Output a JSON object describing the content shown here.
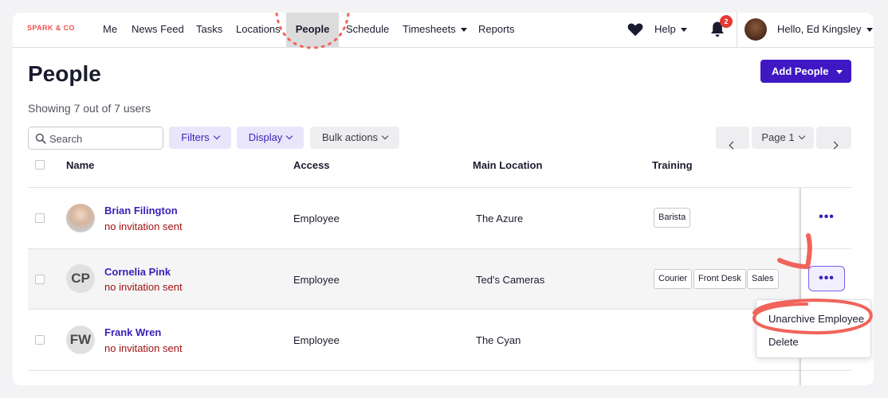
{
  "brand": "SPARK & CO",
  "nav": {
    "items": [
      "Me",
      "News Feed",
      "Tasks",
      "Locations",
      "People",
      "Schedule",
      "Timesheets",
      "Reports"
    ],
    "active": "People",
    "help_label": "Help",
    "notification_count": "2",
    "user_greeting": "Hello, Ed Kingsley"
  },
  "header": {
    "title": "People",
    "add_button": "Add People",
    "showing": "Showing 7 out of 7 users"
  },
  "toolbar": {
    "search_placeholder": "Search",
    "filters": "Filters",
    "display": "Display",
    "bulk_actions": "Bulk actions",
    "page_label": "Page 1"
  },
  "table": {
    "columns": [
      "Name",
      "Access",
      "Main Location",
      "Training"
    ],
    "rows": [
      {
        "initials": "",
        "name": "Brian Filington",
        "status": "no invitation sent",
        "access": "Employee",
        "location": "The Azure",
        "training": [
          "Barista"
        ]
      },
      {
        "initials": "CP",
        "name": "Cornelia Pink",
        "status": "no invitation sent",
        "access": "Employee",
        "location": "Ted's Cameras",
        "training": [
          "Courier",
          "Front Desk",
          "Sales"
        ]
      },
      {
        "initials": "FW",
        "name": "Frank Wren",
        "status": "no invitation sent",
        "access": "Employee",
        "location": "The Cyan",
        "training": []
      }
    ]
  },
  "row_menu": {
    "items": [
      "Unarchive Employee",
      "Delete"
    ]
  },
  "colors": {
    "accent": "#3f18c4",
    "link": "#3a1fb8",
    "status": "#a01414",
    "annotation": "#f0645a"
  }
}
